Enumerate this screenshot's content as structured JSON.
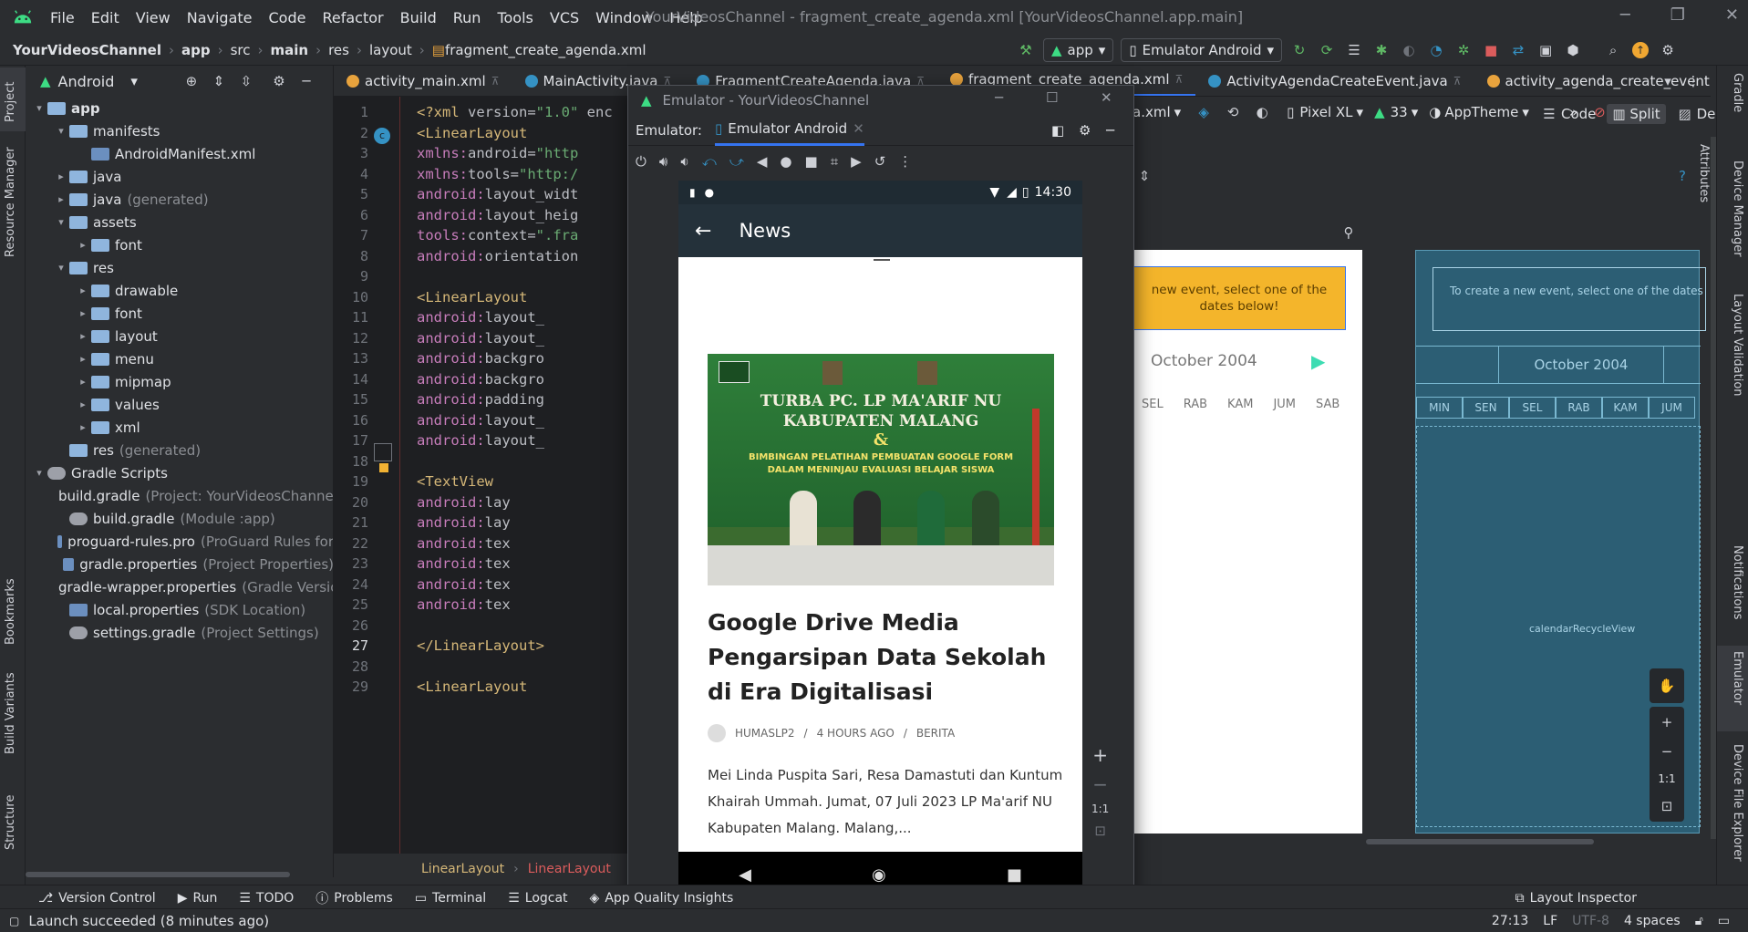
{
  "titlebar": {
    "menu": [
      "File",
      "Edit",
      "View",
      "Navigate",
      "Code",
      "Refactor",
      "Build",
      "Run",
      "Tools",
      "VCS",
      "Window",
      "Help"
    ],
    "title": "YourVideosChannel - fragment_create_agenda.xml [YourVideosChannel.app.main]"
  },
  "navbar": {
    "breadcrumb": [
      "YourVideosChannel",
      "app",
      "src",
      "main",
      "res",
      "layout",
      "fragment_create_agenda.xml"
    ],
    "run_config": "app",
    "device": "Emulator Android"
  },
  "project_panel": {
    "view_mode": "Android",
    "tree": [
      {
        "label": "app",
        "extra": "",
        "level": 0,
        "arrow": "▾",
        "kind": "folder"
      },
      {
        "label": "manifests",
        "extra": "",
        "level": 1,
        "arrow": "▾",
        "kind": "folder"
      },
      {
        "label": "AndroidManifest.xml",
        "extra": "",
        "level": 2,
        "arrow": "",
        "kind": "file"
      },
      {
        "label": "java",
        "extra": "",
        "level": 1,
        "arrow": "▸",
        "kind": "folder"
      },
      {
        "label": "java",
        "extra": "(generated)",
        "level": 1,
        "arrow": "▸",
        "kind": "folder"
      },
      {
        "label": "assets",
        "extra": "",
        "level": 1,
        "arrow": "▾",
        "kind": "folder"
      },
      {
        "label": "font",
        "extra": "",
        "level": 2,
        "arrow": "▸",
        "kind": "folder"
      },
      {
        "label": "res",
        "extra": "",
        "level": 1,
        "arrow": "▾",
        "kind": "folder"
      },
      {
        "label": "drawable",
        "extra": "",
        "level": 2,
        "arrow": "▸",
        "kind": "folder"
      },
      {
        "label": "font",
        "extra": "",
        "level": 2,
        "arrow": "▸",
        "kind": "folder"
      },
      {
        "label": "layout",
        "extra": "",
        "level": 2,
        "arrow": "▸",
        "kind": "folder"
      },
      {
        "label": "menu",
        "extra": "",
        "level": 2,
        "arrow": "▸",
        "kind": "folder"
      },
      {
        "label": "mipmap",
        "extra": "",
        "level": 2,
        "arrow": "▸",
        "kind": "folder"
      },
      {
        "label": "values",
        "extra": "",
        "level": 2,
        "arrow": "▸",
        "kind": "folder"
      },
      {
        "label": "xml",
        "extra": "",
        "level": 2,
        "arrow": "▸",
        "kind": "folder"
      },
      {
        "label": "res",
        "extra": "(generated)",
        "level": 1,
        "arrow": "",
        "kind": "folder"
      },
      {
        "label": "Gradle Scripts",
        "extra": "",
        "level": 0,
        "arrow": "▾",
        "kind": "gradle"
      },
      {
        "label": "build.gradle",
        "extra": "(Project: YourVideosChannel)",
        "level": 1,
        "arrow": "",
        "kind": "gradle"
      },
      {
        "label": "build.gradle",
        "extra": "(Module :app)",
        "level": 1,
        "arrow": "",
        "kind": "gradle"
      },
      {
        "label": "proguard-rules.pro",
        "extra": "(ProGuard Rules for",
        "level": 1,
        "arrow": "",
        "kind": "file"
      },
      {
        "label": "gradle.properties",
        "extra": "(Project Properties)",
        "level": 1,
        "arrow": "",
        "kind": "file"
      },
      {
        "label": "gradle-wrapper.properties",
        "extra": "(Gradle Version)",
        "level": 1,
        "arrow": "",
        "kind": "file"
      },
      {
        "label": "local.properties",
        "extra": "(SDK Location)",
        "level": 1,
        "arrow": "",
        "kind": "file"
      },
      {
        "label": "settings.gradle",
        "extra": "(Project Settings)",
        "level": 1,
        "arrow": "",
        "kind": "gradle"
      }
    ]
  },
  "editor_tabs": [
    {
      "label": "activity_main.xml",
      "color": "#e8a33d",
      "active": false
    },
    {
      "label": "MainActivity.java",
      "color": "#3592c4",
      "active": false
    },
    {
      "label": "FragmentCreateAgenda.java",
      "color": "#3592c4",
      "active": false
    },
    {
      "label": "fragment_create_agenda.xml",
      "color": "#e8a33d",
      "active": true
    },
    {
      "label": "ActivityAgendaCreateEvent.java",
      "color": "#3592c4",
      "active": false
    },
    {
      "label": "activity_agenda_create_event.xml",
      "color": "#e8a33d",
      "active": false
    }
  ],
  "code_lines": [
    {
      "n": "1",
      "html": [
        [
          "tag",
          "<?xml "
        ],
        [
          "attr",
          "version="
        ],
        [
          "str",
          "\"1.0\""
        ],
        [
          "attr",
          " enc"
        ]
      ]
    },
    {
      "n": "2",
      "html": [
        [
          "tag",
          "<LinearLayout"
        ]
      ]
    },
    {
      "n": "3",
      "html": [
        [
          "ns",
          "    xmlns:"
        ],
        [
          "attr",
          "android="
        ],
        [
          "str",
          "\"http"
        ]
      ]
    },
    {
      "n": "4",
      "html": [
        [
          "ns",
          "    xmlns:"
        ],
        [
          "attr",
          "tools="
        ],
        [
          "str",
          "\"http:/"
        ]
      ]
    },
    {
      "n": "5",
      "html": [
        [
          "ns",
          "    android:"
        ],
        [
          "attr",
          "layout_widt"
        ]
      ]
    },
    {
      "n": "6",
      "html": [
        [
          "ns",
          "    android:"
        ],
        [
          "attr",
          "layout_heig"
        ]
      ]
    },
    {
      "n": "7",
      "html": [
        [
          "ns",
          "    tools:"
        ],
        [
          "attr",
          "context="
        ],
        [
          "str",
          "\".fra"
        ]
      ]
    },
    {
      "n": "8",
      "html": [
        [
          "ns",
          "    android:"
        ],
        [
          "attr",
          "orientation"
        ]
      ]
    },
    {
      "n": "9",
      "html": []
    },
    {
      "n": "10",
      "html": [
        [
          "tag",
          "    <LinearLayout"
        ]
      ]
    },
    {
      "n": "11",
      "html": [
        [
          "ns",
          "        android:"
        ],
        [
          "attr",
          "layout_"
        ]
      ]
    },
    {
      "n": "12",
      "html": [
        [
          "ns",
          "        android:"
        ],
        [
          "attr",
          "layout_"
        ]
      ]
    },
    {
      "n": "13",
      "html": [
        [
          "ns",
          "        android:"
        ],
        [
          "attr",
          "backgro"
        ]
      ]
    },
    {
      "n": "14",
      "html": [
        [
          "ns",
          "        android:"
        ],
        [
          "attr",
          "backgro"
        ]
      ]
    },
    {
      "n": "15",
      "html": [
        [
          "ns",
          "        android:"
        ],
        [
          "attr",
          "padding"
        ]
      ]
    },
    {
      "n": "16",
      "html": [
        [
          "ns",
          "        android:"
        ],
        [
          "attr",
          "layout_"
        ]
      ]
    },
    {
      "n": "17",
      "html": [
        [
          "ns",
          "        android:"
        ],
        [
          "attr",
          "layout_"
        ]
      ]
    },
    {
      "n": "18",
      "html": []
    },
    {
      "n": "19",
      "html": [
        [
          "tag",
          "        <TextView"
        ]
      ]
    },
    {
      "n": "20",
      "html": [
        [
          "ns",
          "            android:"
        ],
        [
          "attr",
          "lay"
        ]
      ]
    },
    {
      "n": "21",
      "html": [
        [
          "ns",
          "            android:"
        ],
        [
          "attr",
          "lay"
        ]
      ]
    },
    {
      "n": "22",
      "html": [
        [
          "ns",
          "            android:"
        ],
        [
          "attr",
          "tex"
        ]
      ]
    },
    {
      "n": "23",
      "html": [
        [
          "ns",
          "            android:"
        ],
        [
          "attr",
          "tex"
        ]
      ]
    },
    {
      "n": "24",
      "html": [
        [
          "ns",
          "            android:"
        ],
        [
          "attr",
          "tex"
        ]
      ]
    },
    {
      "n": "25",
      "html": [
        [
          "ns",
          "            android:"
        ],
        [
          "attr",
          "tex"
        ]
      ]
    },
    {
      "n": "26",
      "html": []
    },
    {
      "n": "27",
      "html": [
        [
          "tag",
          "    </LinearLayout>"
        ]
      ]
    },
    {
      "n": "28",
      "html": []
    },
    {
      "n": "29",
      "html": [
        [
          "tag",
          "    <LinearLayout"
        ]
      ]
    }
  ],
  "editor_breadcrumb": [
    "LinearLayout",
    "LinearLayout"
  ],
  "design": {
    "view_modes": [
      "Code",
      "Split",
      "Design"
    ],
    "file_suffix": "a.xml",
    "device": "Pixel XL",
    "api": "33",
    "theme": "AppTheme",
    "preview_banner": "new event, select one of the dates below!",
    "preview_month": "October 2004",
    "preview_days": [
      "SEL",
      "RAB",
      "KAM",
      "JUM",
      "SAB"
    ],
    "blueprint_banner": "To create a new event, select one of the dates belo",
    "blueprint_month": "October 2004",
    "blueprint_days": [
      "MIN",
      "SEN",
      "SEL",
      "RAB",
      "KAM",
      "JUM"
    ],
    "blueprint_recycler": "calendarRecycleView",
    "zoom_ratio": "1:1"
  },
  "emulator": {
    "window_title": "Emulator - YourVideosChannel",
    "label": "Emulator:",
    "tab": "Emulator Android",
    "time": "14:30",
    "app_title": "News",
    "image_heading_1": "TURBA PC. LP MA'ARIF NU",
    "image_heading_2": "KABUPATEN MALANG",
    "image_heading_3": "&",
    "image_sub_1": "BIMBINGAN PELATIHAN PEMBUATAN GOOGLE FORM",
    "image_sub_2": "DALAM MENINJAU EVALUASI BELAJAR SISWA",
    "article_title": "Google Drive Media Pengarsipan Data Sekolah di Era Digitalisasi",
    "author": "HUMASLP2",
    "time_ago": "4 HOURS AGO",
    "category": "BERITA",
    "excerpt": "Mei Linda Puspita Sari, Resa Damastuti dan Kuntum Khairah Ummah. Jumat, 07 Juli 2023 LP Ma'arif NU Kabupaten Malang. Malang,...",
    "zoom_ratio": "1:1"
  },
  "bottom_tools": [
    "Version Control",
    "Run",
    "TODO",
    "Problems",
    "Terminal",
    "Logcat",
    "App Quality Insights"
  ],
  "layout_inspector": "Layout Inspector",
  "status": {
    "message": "Launch succeeded (8 minutes ago)",
    "position": "27:13",
    "line_sep": "LF",
    "encoding": "UTF-8",
    "indent": "4 spaces"
  },
  "left_stripe": [
    "Project",
    "Resource Manager",
    "Bookmarks",
    "Build Variants",
    "Structure"
  ],
  "right_stripe": [
    "Gradle",
    "Device Manager",
    "Layout Validation",
    "Notifications",
    "Emulator",
    "Device File Explorer"
  ],
  "design_side": [
    "Attributes"
  ]
}
